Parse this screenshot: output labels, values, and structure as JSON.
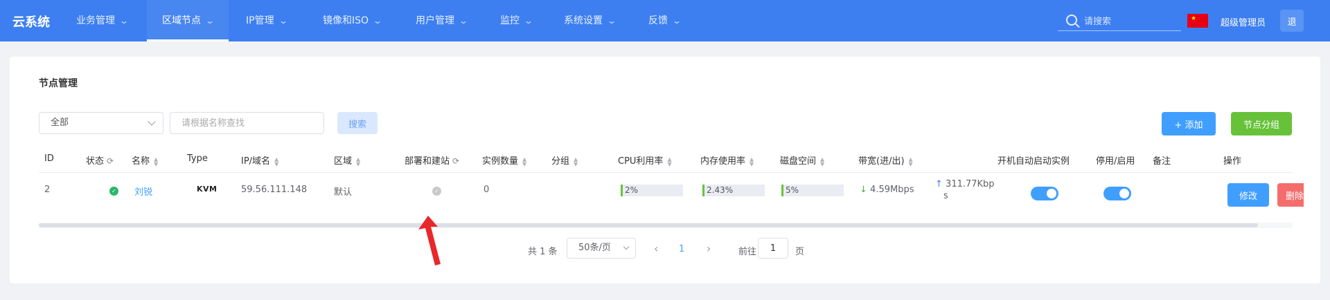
{
  "app": {
    "brand": "云系统"
  },
  "nav": {
    "items": [
      {
        "label": "业务管理"
      },
      {
        "label": "区域节点"
      },
      {
        "label": "IP管理"
      },
      {
        "label": "镜像和ISO"
      },
      {
        "label": "用户管理"
      },
      {
        "label": "监控"
      },
      {
        "label": "系统设置"
      },
      {
        "label": "反馈"
      }
    ],
    "active_index": 1,
    "search_placeholder": "请搜索",
    "user_name": "超级管理员",
    "user_btn": "退"
  },
  "page": {
    "title": "节点管理",
    "filter_select": "全部",
    "name_placeholder": "请根据名称查找",
    "search_btn": "搜索",
    "add_btn": "+ 添加",
    "group_btn": "节点分组"
  },
  "table": {
    "headers": {
      "id": "ID",
      "status": "状态",
      "name": "名称",
      "type": "Type",
      "ip": "IP/域名",
      "region": "区域",
      "sync": "部署和建站",
      "instances": "实例数量",
      "group": "分组",
      "cpu": "CPU利用率",
      "mem": "内存使用率",
      "disk": "磁盘空间",
      "bandwidth": "带宽(进/出)",
      "autostart": "开机自动启动实例",
      "enable": "停用/启用",
      "remark": "备注",
      "ops": "操作"
    },
    "rows": [
      {
        "id": "2",
        "name": "刘锐",
        "type": "KVM",
        "ip": "59.56.111.148",
        "region": "默认",
        "instances": "0",
        "group": "",
        "cpu": "2%",
        "cpu_value": 2,
        "mem": "2.43%",
        "mem_value": 2.43,
        "disk": "5%",
        "disk_value": 5,
        "bw_in": "4.59Mbps",
        "bw_out": "311.77Kbp",
        "bw_out_2": "s",
        "autostart": true,
        "enabled": true,
        "edit_btn": "修改",
        "delete_btn": "删除"
      }
    ]
  },
  "pagination": {
    "total": "共 1 条",
    "page_size": "50条/页",
    "current": "1",
    "goto_prefix": "前往",
    "goto_value": "1",
    "goto_suffix": "页"
  },
  "colors": {
    "nav_bg": "#3d7ff0",
    "primary": "#409eff",
    "success": "#67c23a",
    "danger": "#f56c6c",
    "annotation": "#e8272b"
  }
}
